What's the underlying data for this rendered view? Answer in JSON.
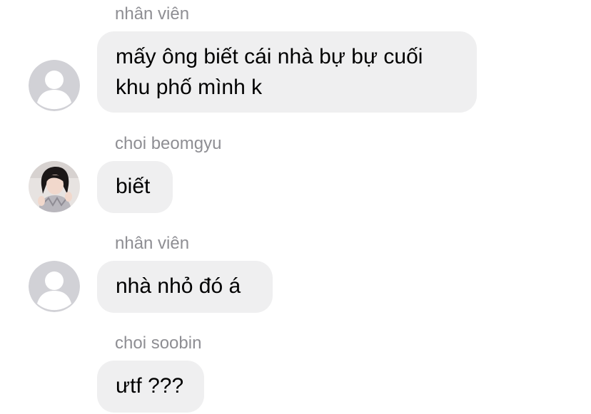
{
  "messages": [
    {
      "sender": "nhân viên",
      "lines": [
        "mấy ông biết cái nhà bự bự cuối",
        "khu phố mình k"
      ],
      "avatar": "default-avatar-icon"
    },
    {
      "sender": "choi beomgyu",
      "lines": [
        "biết"
      ],
      "avatar": "profile-photo"
    },
    {
      "sender": "nhân viên",
      "lines": [
        "nhà nhỏ đó á"
      ],
      "avatar": "default-avatar-icon"
    },
    {
      "sender": "choi soobin",
      "lines": [
        "ưtf ???"
      ],
      "avatar": ""
    }
  ],
  "colors": {
    "bubble": "#efeff0",
    "sender_text": "#8e8e93",
    "message_text": "#000000",
    "default_avatar_bg": "#d1d1d6"
  }
}
